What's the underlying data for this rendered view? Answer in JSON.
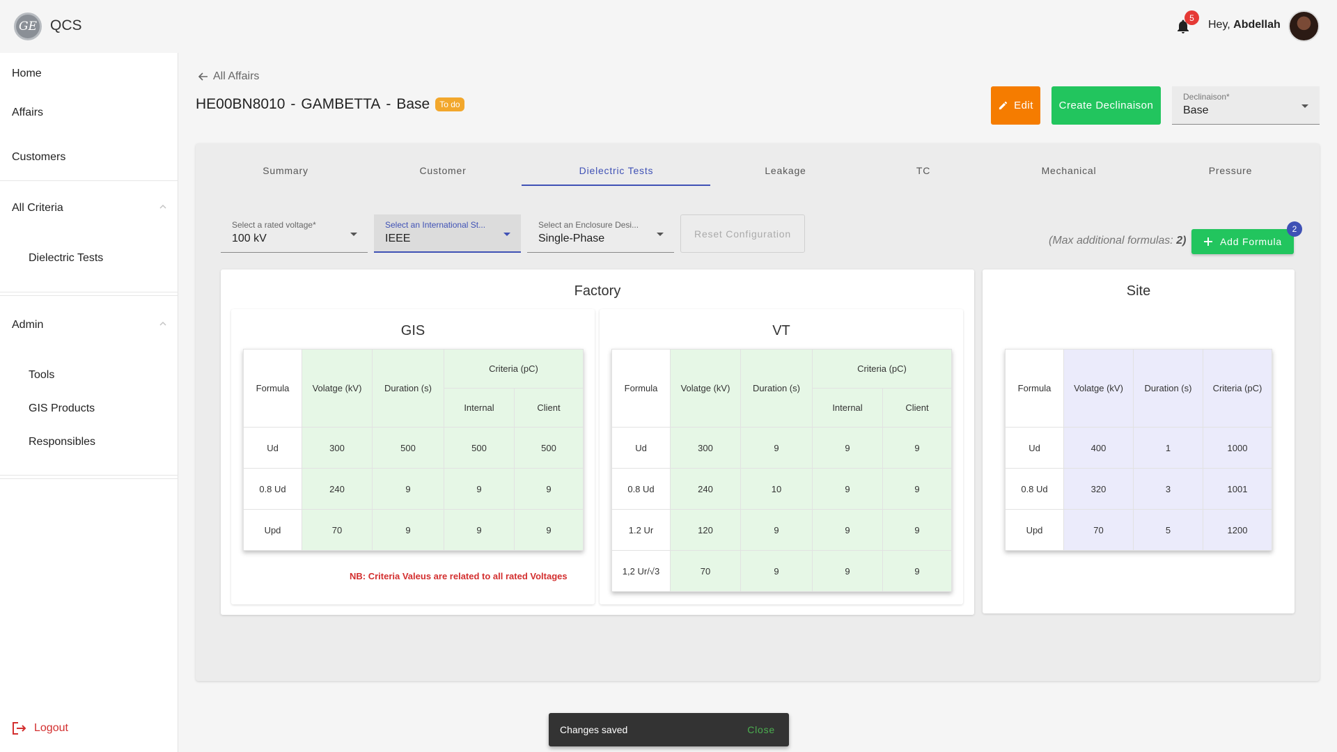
{
  "app": {
    "title": "QCS",
    "logo_text": "GE"
  },
  "header": {
    "notification_count": "5",
    "greeting_prefix": "Hey,",
    "user_name": "Abdellah"
  },
  "sidebar": {
    "home": "Home",
    "affairs": "Affairs",
    "customers": "Customers",
    "all_criteria": "All Criteria",
    "dielectric_tests": "Dielectric Tests",
    "admin": "Admin",
    "tools": "Tools",
    "gis_products": "GIS Products",
    "responsibles": "Responsibles",
    "logout": "Logout"
  },
  "page": {
    "back_label": "All Affairs",
    "affair_code": "HE00BN8010",
    "sep1": "-",
    "affair_name": "GAMBETTA",
    "sep2": "-",
    "variant": "Base",
    "status_badge": "To do",
    "edit_label": "Edit",
    "create_label": "Create Declinaison",
    "declinaison_label": "Declinaison*",
    "declinaison_value": "Base"
  },
  "tabs": [
    "Summary",
    "Customer",
    "Dielectric Tests",
    "Leakage",
    "TC",
    "Mechanical",
    "Pressure"
  ],
  "active_tab": "Dielectric Tests",
  "filters": {
    "voltage_label": "Select a rated voltage*",
    "voltage_value": "100 kV",
    "standard_label": "Select an International St...",
    "standard_value": "IEEE",
    "enclosure_label": "Select an Enclosure Desi...",
    "enclosure_value": "Single-Phase",
    "reset_label": "Reset Configuration",
    "max_text": "(Max additional formulas:",
    "max_value": "2)",
    "add_label": "Add Formula",
    "add_badge": "2"
  },
  "factory": {
    "title": "Factory",
    "gis": {
      "title": "GIS",
      "headers": {
        "formula": "Formula",
        "voltage": "Volatge (kV)",
        "duration": "Duration (s)",
        "criteria": "Criteria (pC)",
        "internal": "Internal",
        "client": "Client"
      },
      "rows": [
        [
          "Ud",
          "300",
          "500",
          "500",
          "500"
        ],
        [
          "0.8 Ud",
          "240",
          "9",
          "9",
          "9"
        ],
        [
          "Upd",
          "70",
          "9",
          "9",
          "9"
        ]
      ],
      "note": "NB: Criteria Valeus are related to all rated Voltages"
    },
    "vt": {
      "title": "VT",
      "headers": {
        "formula": "Formula",
        "voltage": "Volatge (kV)",
        "duration": "Duration (s)",
        "criteria": "Criteria (pC)",
        "internal": "Internal",
        "client": "Client"
      },
      "rows": [
        [
          "Ud",
          "300",
          "9",
          "9",
          "9"
        ],
        [
          "0.8 Ud",
          "240",
          "10",
          "9",
          "9"
        ],
        [
          "1.2 Ur",
          "120",
          "9",
          "9",
          "9"
        ],
        [
          "1,2 Ur/√3",
          "70",
          "9",
          "9",
          "9"
        ]
      ]
    }
  },
  "site": {
    "title": "Site",
    "headers": {
      "formula": "Formula",
      "voltage": "Volatge (kV)",
      "duration": "Duration (s)",
      "criteria": "Criteria (pC)"
    },
    "rows": [
      [
        "Ud",
        "400",
        "1",
        "1000"
      ],
      [
        "0.8 Ud",
        "320",
        "3",
        "1001"
      ],
      [
        "Upd",
        "70",
        "5",
        "1200"
      ]
    ]
  },
  "snackbar": {
    "message": "Changes saved",
    "close": "Close"
  }
}
